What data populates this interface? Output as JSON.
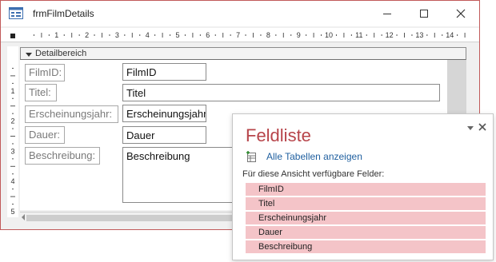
{
  "window": {
    "title": "frmFilmDetails",
    "controls": [
      "minimize",
      "maximize",
      "close"
    ]
  },
  "ruler": {
    "horizontal_numbers": [
      "1",
      "2",
      "3",
      "4",
      "5",
      "6",
      "7",
      "8",
      "9",
      "10",
      "11",
      "12",
      "13",
      "14"
    ],
    "vertical_numbers": [
      "1",
      "2",
      "3",
      "4",
      "5"
    ]
  },
  "section": {
    "label": "Detailbereich"
  },
  "form": {
    "labels": [
      "FilmID:",
      "Titel:",
      "Erscheinungsjahr:",
      "Dauer:",
      "Beschreibung:"
    ],
    "textboxes": [
      "FilmID",
      "Titel",
      "Erscheinungsjahr",
      "Dauer",
      "Beschreibung"
    ]
  },
  "fieldlist": {
    "title": "Feldliste",
    "show_all": "Alle Tabellen anzeigen",
    "available_label": "Für diese Ansicht verfügbare Felder:",
    "fields": [
      "FilmID",
      "Titel",
      "Erscheinungsjahr",
      "Dauer",
      "Beschreibung"
    ]
  },
  "colors": {
    "window_border": "#c15a5a",
    "pane_title": "#b7444a",
    "field_highlight": "#f4c4c8",
    "link": "#1f5f9f"
  }
}
